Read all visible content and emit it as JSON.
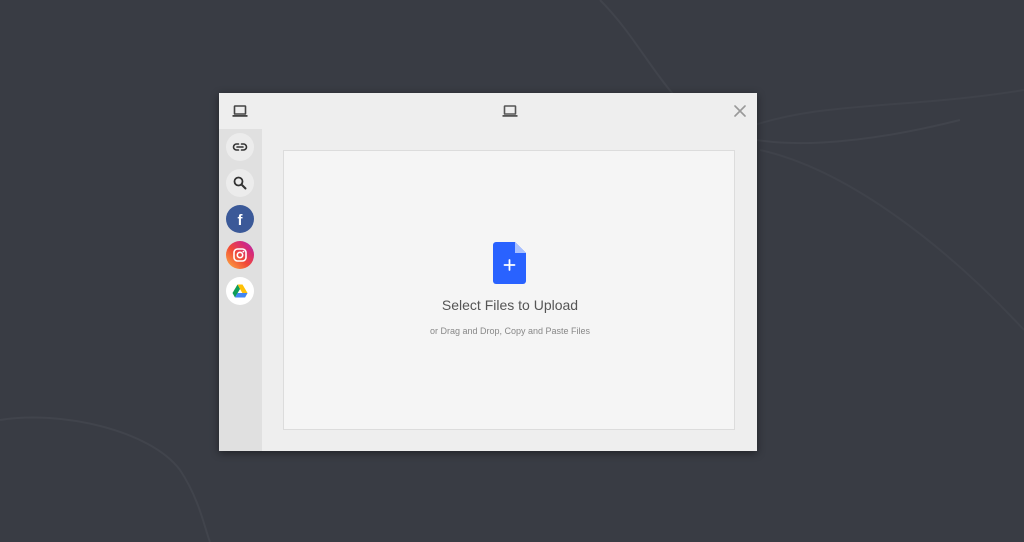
{
  "dialog": {
    "header_icon": "laptop-icon",
    "center_icon": "laptop-icon",
    "close_icon": "close-icon"
  },
  "sidebar": {
    "items": [
      {
        "name": "link",
        "icon": "link-icon"
      },
      {
        "name": "search",
        "icon": "search-icon"
      },
      {
        "name": "facebook",
        "icon": "facebook-icon",
        "label": "f",
        "color": "#3b5998"
      },
      {
        "name": "instagram",
        "icon": "instagram-icon"
      },
      {
        "name": "google-drive",
        "icon": "google-drive-icon"
      }
    ]
  },
  "dropzone": {
    "icon": "file-add-icon",
    "title": "Select Files to Upload",
    "subtitle": "or Drag and Drop, Copy and Paste Files",
    "accent_color": "#2962ff"
  },
  "colors": {
    "background": "#393c44",
    "modal": "#eeeeee",
    "sidebar": "#e0e0e0",
    "dropzone": "#f5f5f5"
  }
}
